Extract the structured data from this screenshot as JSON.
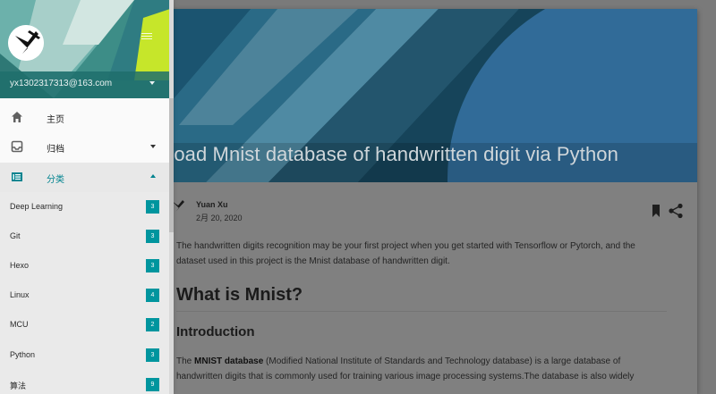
{
  "post": {
    "title": "Load Mnist database of handwritten digit via Python",
    "author": "Yuan Xu",
    "date": "2月 20, 2020",
    "intro": "The handwritten digits recognition may be your first project when you get started with Tensorflow or Pytorch, and the dataset used in this project is the Mnist database of handwritten digit.",
    "h1": "What is Mnist?",
    "h2": "Introduction",
    "para_bold": "MNIST database",
    "para_rest": " (Modified National Institute of Standards and Technology database) is a large database of handwritten digits that is commonly used for training various image processing systems.The database is also widely",
    "para_lead": "The "
  },
  "drawer": {
    "email": "yx1302317313@163.com",
    "nav": [
      {
        "label": "主页",
        "icon": "home-icon"
      },
      {
        "label": "归档",
        "icon": "archive-icon"
      },
      {
        "label": "分类",
        "icon": "category-icon"
      }
    ],
    "categories": [
      {
        "label": "Deep Learning",
        "count": "3"
      },
      {
        "label": "Git",
        "count": "3"
      },
      {
        "label": "Hexo",
        "count": "3"
      },
      {
        "label": "Linux",
        "count": "4"
      },
      {
        "label": "MCU",
        "count": "2"
      },
      {
        "label": "Python",
        "count": "3"
      },
      {
        "label": "算法",
        "count": "9"
      }
    ]
  },
  "colors": {
    "accent": "#00838f",
    "badge": "#00959e",
    "overlay": "#7a7a7a"
  }
}
